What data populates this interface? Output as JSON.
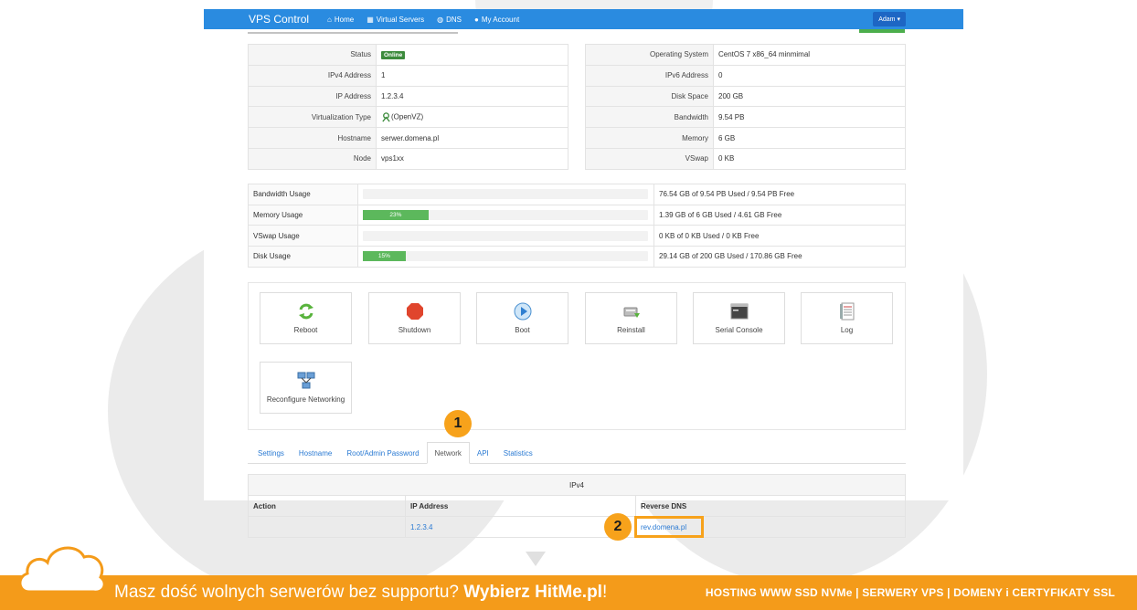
{
  "navbar": {
    "brand": "VPS Control",
    "items": [
      {
        "icon": "home-icon",
        "label": "Home"
      },
      {
        "icon": "grid-icon",
        "label": "Virtual Servers"
      },
      {
        "icon": "globe-icon",
        "label": "DNS"
      },
      {
        "icon": "user-icon",
        "label": "My Account"
      }
    ],
    "user": "Adam"
  },
  "info_left": [
    {
      "label": "Status",
      "value": "Online"
    },
    {
      "label": "IPv4 Address",
      "value": "1"
    },
    {
      "label": "IP Address",
      "value": "1.2.3.4"
    },
    {
      "label": "Virtualization Type",
      "value": "(OpenVZ)"
    },
    {
      "label": "Hostname",
      "value": "serwer.domena.pl"
    },
    {
      "label": "Node",
      "value": "vps1xx"
    }
  ],
  "info_right": [
    {
      "label": "Operating System",
      "value": "CentOS 7 x86_64 minmimal"
    },
    {
      "label": "IPv6 Address",
      "value": "0"
    },
    {
      "label": "Disk Space",
      "value": "200 GB"
    },
    {
      "label": "Bandwidth",
      "value": "9.54 PB"
    },
    {
      "label": "Memory",
      "value": "6 GB"
    },
    {
      "label": "VSwap",
      "value": "0 KB"
    }
  ],
  "usage": [
    {
      "label": "Bandwidth Usage",
      "percent": 0,
      "percent_label": "",
      "text": "76.54 GB of 9.54 PB Used / 9.54 PB Free"
    },
    {
      "label": "Memory Usage",
      "percent": 23,
      "percent_label": "23%",
      "text": "1.39 GB of 6 GB Used / 4.61 GB Free"
    },
    {
      "label": "VSwap Usage",
      "percent": 0,
      "percent_label": "",
      "text": "0 KB of 0 KB Used / 0 KB Free"
    },
    {
      "label": "Disk Usage",
      "percent": 15,
      "percent_label": "15%",
      "text": "29.14 GB of 200 GB Used / 170.86 GB Free"
    }
  ],
  "actions": [
    {
      "label": "Reboot",
      "icon": "reboot-icon"
    },
    {
      "label": "Shutdown",
      "icon": "shutdown-icon"
    },
    {
      "label": "Boot",
      "icon": "boot-icon"
    },
    {
      "label": "Reinstall",
      "icon": "reinstall-icon"
    },
    {
      "label": "Serial Console",
      "icon": "console-icon"
    },
    {
      "label": "Log",
      "icon": "log-icon"
    },
    {
      "label": "Reconfigure Networking",
      "icon": "network-icon"
    }
  ],
  "tabs": [
    "Settings",
    "Hostname",
    "Root/Admin Password",
    "Network",
    "API",
    "Statistics"
  ],
  "active_tab": "Network",
  "network_table": {
    "section": "IPv4",
    "columns": [
      "Action",
      "IP Address",
      "Reverse DNS"
    ],
    "rows": [
      {
        "action": "",
        "ip": "1.2.3.4",
        "rdns": "rev.domena.pl"
      }
    ]
  },
  "callouts": [
    "1",
    "2"
  ],
  "footer": {
    "message_prefix": "Masz dość wolnych serwerów bez supportu? ",
    "message_bold": "Wybierz HitMe.pl",
    "message_suffix": "!",
    "right": "HOSTING WWW SSD NVMe | SERWERY VPS | DOMENY i CERTYFIKATY SSL"
  },
  "colors": {
    "navbar": "#2a8be0",
    "progress": "#5cb85c",
    "accent": "#f7a21b",
    "footer": "#f49b1a"
  }
}
